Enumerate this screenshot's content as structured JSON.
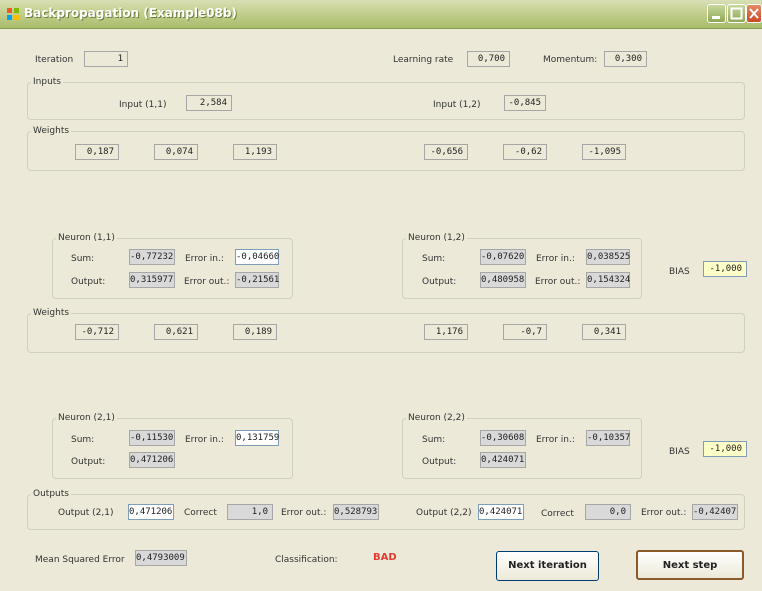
{
  "window": {
    "title": "Backpropagation (Example08b)"
  },
  "iteration": {
    "label": "Iteration",
    "value": "1"
  },
  "learning_rate": {
    "label": "Learning rate",
    "value": "0,700"
  },
  "momentum": {
    "label": "Momentum:",
    "value": "0,300"
  },
  "inputs": {
    "title": "Inputs",
    "input_1_1": {
      "label": "Input (1,1)",
      "value": "2,584"
    },
    "input_1_2": {
      "label": "Input (1,2)",
      "value": "-0,845"
    }
  },
  "weights1": {
    "title": "Weights",
    "values": [
      "0,187",
      "0,074",
      "1,193",
      "-0,656",
      "-0,62",
      "-1,095"
    ]
  },
  "neuron_1_1": {
    "title": "Neuron (1,1)",
    "sum_label": "Sum:",
    "sum": "-0,77232",
    "error_in_label": "Error in.:",
    "error_in": "-0,04660",
    "output_label": "Output:",
    "output": "0,315977",
    "error_out_label": "Error out.:",
    "error_out": "-0,21561"
  },
  "neuron_1_2": {
    "title": "Neuron (1,2)",
    "sum_label": "Sum:",
    "sum": "-0,07620",
    "error_in_label": "Error in.:",
    "error_in": "0,038525",
    "output_label": "Output:",
    "output": "0,480958",
    "error_out_label": "Error out.:",
    "error_out": "0,154324"
  },
  "bias1": {
    "label": "BIAS",
    "value": "-1,000"
  },
  "weights2": {
    "title": "Weights",
    "values": [
      "-0,712",
      "0,621",
      "0,189",
      "1,176",
      "-0,7",
      "0,341"
    ]
  },
  "neuron_2_1": {
    "title": "Neuron (2,1)",
    "sum_label": "Sum:",
    "sum": "-0,11530",
    "error_in_label": "Error in.:",
    "error_in": "0,131759",
    "output_label": "Output:",
    "output": "0,471206"
  },
  "neuron_2_2": {
    "title": "Neuron (2,2)",
    "sum_label": "Sum:",
    "sum": "-0,30608",
    "error_in_label": "Error in.:",
    "error_in": "-0,10357",
    "output_label": "Output:",
    "output": "0,424071"
  },
  "bias2": {
    "label": "BIAS",
    "value": "-1,000"
  },
  "outputs": {
    "title": "Outputs",
    "out1_label": "Output (2,1)",
    "out1": "0,471206",
    "correct1_label": "Correct",
    "correct1": "1,0",
    "err1_label": "Error out.:",
    "err1": "0,528793",
    "out2_label": "Output (2,2)",
    "out2": "0,424071",
    "correct2_label": "Correct",
    "correct2": "0,0",
    "err2_label": "Error out.:",
    "err2": "-0,42407"
  },
  "mse": {
    "label": "Mean Squared Error",
    "value": "0,4793009"
  },
  "classification": {
    "label": "Classification:",
    "value": "BAD",
    "color": "#e03c31"
  },
  "buttons": {
    "next_iteration": "Next iteration",
    "next_step": "Next step"
  }
}
